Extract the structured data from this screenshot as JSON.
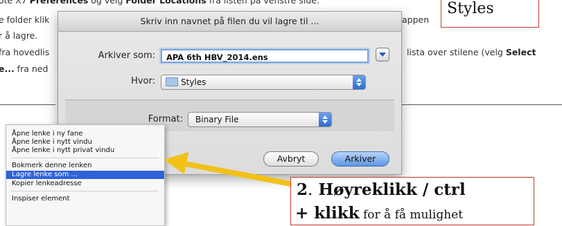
{
  "background_text": {
    "line1_prefix": "ote X7 ",
    "line1_bold": "Preferences",
    "line1_mid": " og velg ",
    "line1_bold2": "Folder Locations",
    "line1_suffix": " fra listen på venstre side.",
    "line2_left": "e folder klik",
    "line2_right": "appen",
    "line3_left": "r å lagre.",
    "line4_left": "fra hovedlis",
    "line4_right": "lista over stilene (velg ",
    "line4_right_bold": "Select",
    "line5_left_bold": "e...",
    "line5_left": " fra ned"
  },
  "styles_label": "Styles",
  "dialog": {
    "title": "Skriv inn navnet på filen du vil lagre til ...",
    "save_as_label": "Arkiver som:",
    "save_as_value": "APA 6th HBV_2014.ens",
    "where_label": "Hvor:",
    "where_value": "Styles",
    "format_label": "Format:",
    "format_value": "Binary File",
    "cancel_label": "Avbryt",
    "save_label": "Arkiver"
  },
  "context_menu": {
    "items": [
      {
        "label": "Åpne lenke i ny fane",
        "highlighted": false
      },
      {
        "label": "Åpne lenke i nytt vindu",
        "highlighted": false
      },
      {
        "label": "Åpne lenke i nytt privat vindu",
        "highlighted": false
      },
      {
        "label": "Bokmerk denne lenken",
        "highlighted": false
      },
      {
        "label": "Lagre lenke som ...",
        "highlighted": true
      },
      {
        "label": "Kopier lenkeadresse",
        "highlighted": false
      },
      {
        "label": "Inspiser element",
        "highlighted": false
      }
    ]
  },
  "instruction": {
    "number": "2",
    "dot": ".",
    "bold_text": " Høyreklikk / ctrl",
    "line2_bold": "+ klikk",
    "line2_rest": " for å få mulighet"
  },
  "colors": {
    "highlight": "#2f62d9",
    "annotation_border": "#c0392b",
    "arrow": "#f2c118"
  }
}
